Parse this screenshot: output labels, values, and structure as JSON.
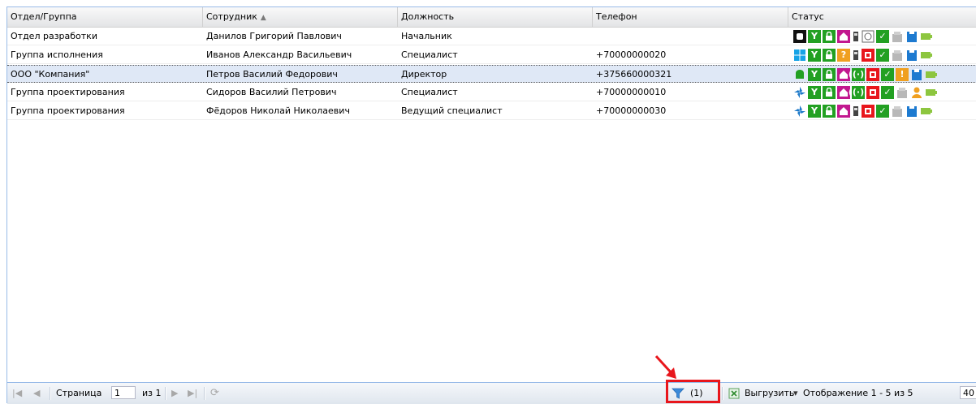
{
  "colors": {
    "accent": "#15428b",
    "highlight": "#e8161c",
    "selected_row": "#dfe8f6",
    "green": "#22a022",
    "magenta": "#c2188f"
  },
  "columns": [
    "Отдел/Группа",
    "Сотрудник",
    "Должность",
    "Телефон",
    "Статус"
  ],
  "sort_indicator": "▲",
  "rows": [
    {
      "dept": "Отдел разработки",
      "employee": "Данилов Григорий Павлович",
      "position": "Начальник",
      "phone": "",
      "os": "apple-icon",
      "selected": false
    },
    {
      "dept": "Группа исполнения",
      "employee": "Иванов Александр Васильевич",
      "position": "Специалист",
      "phone": "+70000000020",
      "os": "windows-icon",
      "selected": false
    },
    {
      "dept": "ООО \"Компания\"",
      "employee": "Петров Василий Федорович",
      "position": "Директор",
      "phone": "+375660000321",
      "os": "android-icon",
      "selected": true
    },
    {
      "dept": "Группа проектирования",
      "employee": "Сидоров Василий Петрович",
      "position": "Специалист",
      "phone": "+70000000010",
      "os": "pinwheel-icon",
      "selected": false
    },
    {
      "dept": "Группа проектирования",
      "employee": "Фёдоров Николай Николаевич",
      "position": "Ведущий специалист",
      "phone": "+70000000030",
      "os": "pinwheel-icon",
      "selected": false
    }
  ],
  "toolbar": {
    "page_label": "Страница",
    "page_value": "1",
    "of_label": "из 1",
    "filter_count": "(1)",
    "export_label": "Выгрузить",
    "export_arrow": "▾",
    "display_label": "Отображение 1 - 5 из 5",
    "page_size": "40"
  }
}
